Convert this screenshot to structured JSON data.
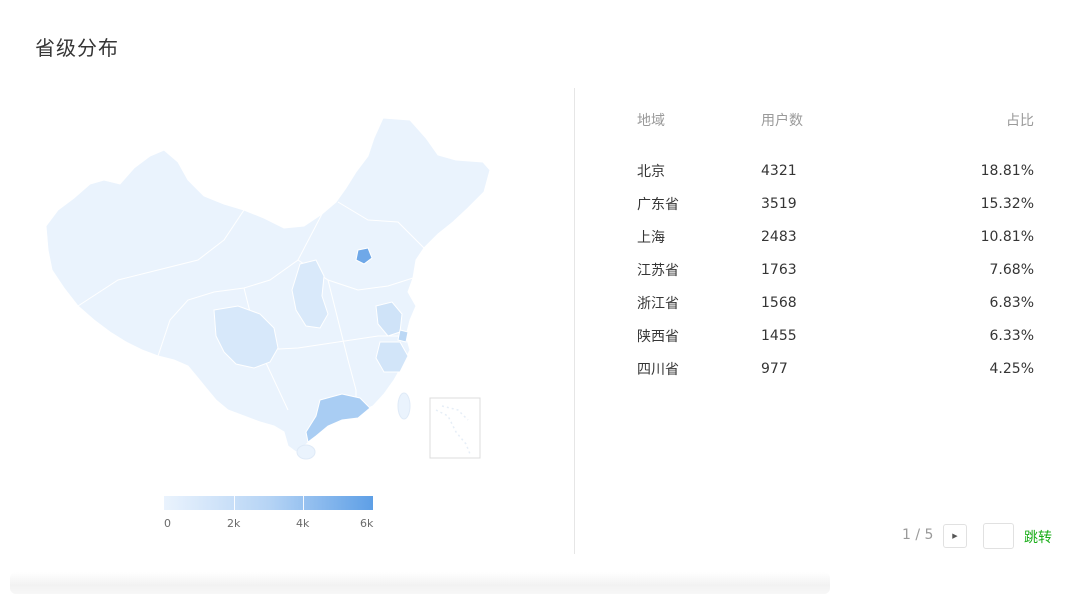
{
  "title": "省级分布",
  "legend": {
    "labels": [
      "0",
      "2k",
      "4k",
      "6k"
    ],
    "min_color": "#eaf3fd",
    "max_color": "#5e9fe6"
  },
  "table": {
    "headers": {
      "region": "地域",
      "users": "用户数",
      "ratio": "占比"
    },
    "rows": [
      {
        "region": "北京",
        "users": "4321",
        "ratio": "18.81%"
      },
      {
        "region": "广东省",
        "users": "3519",
        "ratio": "15.32%"
      },
      {
        "region": "上海",
        "users": "2483",
        "ratio": "10.81%"
      },
      {
        "region": "江苏省",
        "users": "1763",
        "ratio": "7.68%"
      },
      {
        "region": "浙江省",
        "users": "1568",
        "ratio": "6.83%"
      },
      {
        "region": "陕西省",
        "users": "1455",
        "ratio": "6.33%"
      },
      {
        "region": "四川省",
        "users": "977",
        "ratio": "4.25%"
      }
    ]
  },
  "pagination": {
    "page_info": "1 / 5",
    "next_icon": "caret-right-icon",
    "jump_label": "跳转",
    "jump_value": ""
  },
  "colors": {
    "accent": "#1aad19",
    "map_base": "#eaf3fd",
    "map_highlight": "#a9cdf3",
    "map_strong": "#6fa8e8"
  }
}
